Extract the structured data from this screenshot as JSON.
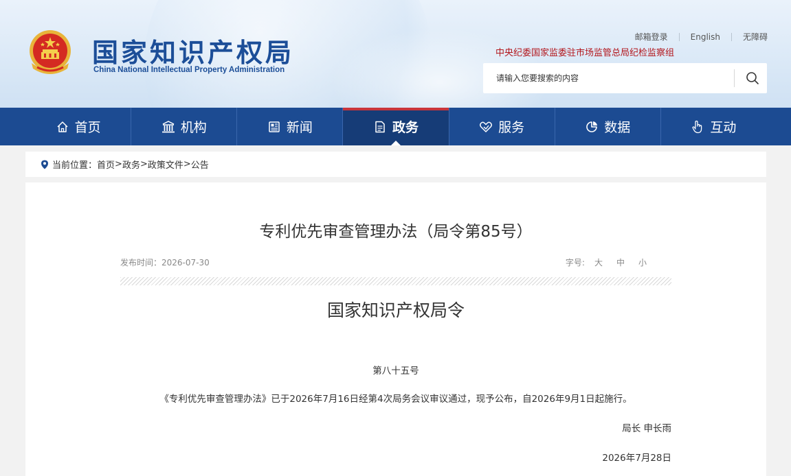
{
  "header": {
    "logo_cn": "国家知识产权局",
    "logo_en": "China National Intellectual Property Administration",
    "links": {
      "mail_login": "邮箱登录",
      "english": "English",
      "accessibility": "无障碍"
    },
    "discipline_link": "中央纪委国家监委驻市场监管总局纪检监察组",
    "search": {
      "placeholder": "请输入您要搜索的内容",
      "icon": "search-icon"
    }
  },
  "nav": {
    "items": [
      {
        "label": "首页",
        "icon": "home-icon",
        "active": false
      },
      {
        "label": "机构",
        "icon": "building-icon",
        "active": false
      },
      {
        "label": "新闻",
        "icon": "newspaper-icon",
        "active": false
      },
      {
        "label": "政务",
        "icon": "document-icon",
        "active": true
      },
      {
        "label": "服务",
        "icon": "handshake-icon",
        "active": false
      },
      {
        "label": "数据",
        "icon": "pie-chart-icon",
        "active": false
      },
      {
        "label": "互动",
        "icon": "pointer-hand-icon",
        "active": false
      }
    ]
  },
  "breadcrumb": {
    "prefix": "当前位置：",
    "items": [
      "首页",
      "政务",
      "政策文件",
      "公告"
    ],
    "separator": ">"
  },
  "article": {
    "title": "专利优先审查管理办法（局令第85号）",
    "published_label": "发布时间：",
    "published_date": "2026-07-30",
    "font_size_label": "字号:",
    "font_sizes": [
      "大",
      "中",
      "小"
    ],
    "order_title": "国家知识产权局令",
    "order_number": "第八十五号",
    "body": "《专利优先审查管理办法》已于2026年7月16日经第4次局务会议审议通过，现予公布，自2026年9月1日起施行。",
    "signer": "局长 申长雨",
    "sign_date": "2026年7月28日"
  },
  "colors": {
    "brand_blue": "#1c4b92",
    "active_accent": "#c9353b",
    "discipline_red": "#b3171d"
  }
}
